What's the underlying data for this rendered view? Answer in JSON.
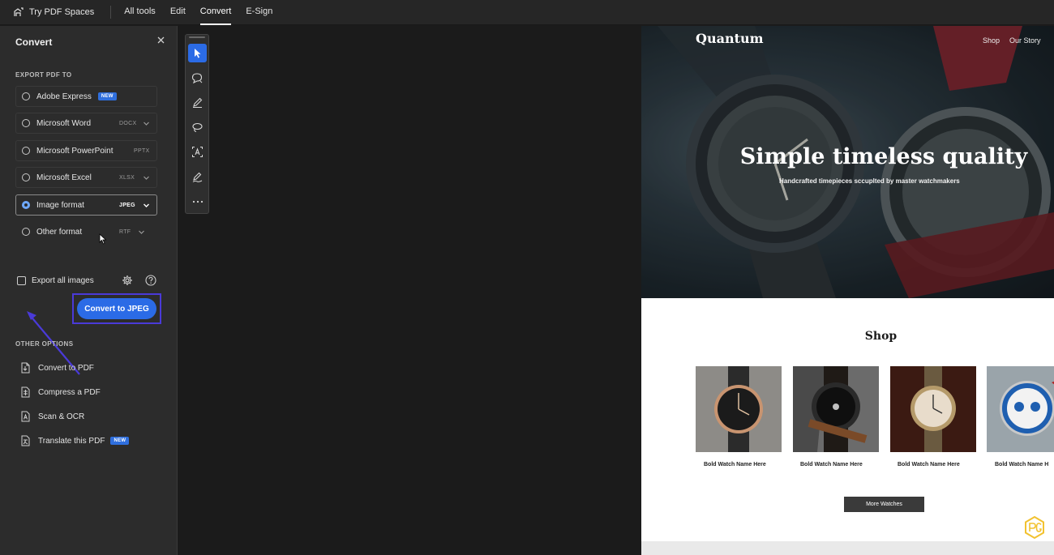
{
  "topbar": {
    "spaces_label": "Try PDF Spaces",
    "nav": [
      "All tools",
      "Edit",
      "Convert",
      "E-Sign"
    ],
    "active_nav": "Convert"
  },
  "panel": {
    "title": "Convert",
    "close_icon": "close-icon",
    "export_label": "EXPORT PDF TO",
    "options": [
      {
        "label": "Adobe Express",
        "badge": "NEW",
        "ext": "",
        "selected": false
      },
      {
        "label": "Microsoft Word",
        "ext": "DOCX",
        "selected": false
      },
      {
        "label": "Microsoft PowerPoint",
        "ext": "PPTX",
        "selected": false
      },
      {
        "label": "Microsoft Excel",
        "ext": "XLSX",
        "selected": false
      },
      {
        "label": "Image format",
        "ext": "JPEG",
        "selected": true
      },
      {
        "label": "Other format",
        "ext": "RTF",
        "selected": false
      }
    ],
    "export_all_images": "Export all images",
    "convert_button": "Convert to JPEG",
    "other_options_label": "OTHER OPTIONS",
    "other_options": [
      {
        "label": "Convert to PDF"
      },
      {
        "label": "Compress a PDF"
      },
      {
        "label": "Scan & OCR"
      },
      {
        "label": "Translate this PDF",
        "badge": "NEW"
      }
    ]
  },
  "toolbar": {
    "tools": [
      "select-cursor-icon",
      "comment-icon",
      "pen-icon",
      "lasso-icon",
      "text-recognition-icon",
      "signature-icon",
      "more-icon"
    ]
  },
  "preview": {
    "brand": "Quantum",
    "nav": [
      "Shop",
      "Our Story"
    ],
    "hero_title": "Simple timeless quality",
    "hero_subtitle": "Handcrafted timepieces sccuplted by master watchmakers",
    "shop_title": "Shop",
    "products": [
      {
        "name": "Bold Watch Name Here"
      },
      {
        "name": "Bold Watch Name Here"
      },
      {
        "name": "Bold Watch Name Here"
      },
      {
        "name": "Bold Watch Name H"
      }
    ],
    "more_button": "More Watches"
  },
  "colors": {
    "accent": "#2b6be6",
    "highlight_frame": "#4a3ad8",
    "panel_bg": "#2c2c2c",
    "badge": "#2f6fde"
  }
}
